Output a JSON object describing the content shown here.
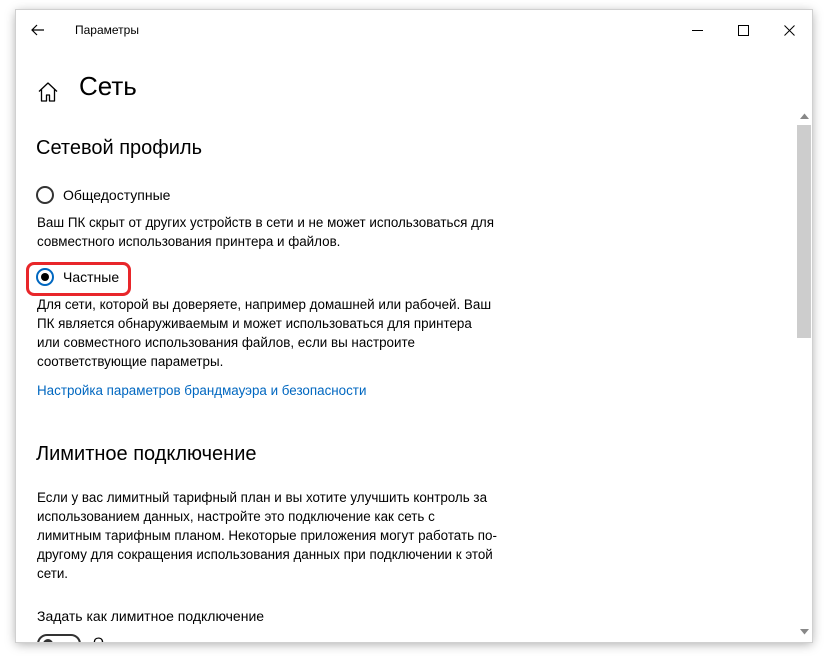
{
  "window": {
    "title": "Параметры"
  },
  "page": {
    "title": "Сеть"
  },
  "network_profile": {
    "heading": "Сетевой профиль",
    "options": [
      {
        "label": "Общедоступные",
        "checked": false,
        "description": "Ваш ПК скрыт от других устройств в сети и не может использоваться для совместного использования принтера и файлов."
      },
      {
        "label": "Частные",
        "checked": true,
        "description": "Для сети, которой вы доверяете, например домашней или рабочей. Ваш ПК является обнаруживаемым и может использоваться для принтера или совместного использования файлов, если вы настроите соответствующие параметры."
      }
    ],
    "firewall_link": "Настройка параметров брандмауэра и безопасности"
  },
  "metered": {
    "heading": "Лимитное подключение",
    "description": "Если у вас лимитный тарифный план и вы хотите улучшить контроль за использованием данных, настройте это подключение как сеть с лимитным тарифным планом. Некоторые приложения могут работать по-другому для сокращения использования данных при подключении к этой сети.",
    "toggle_label": "Задать как лимитное подключение",
    "toggle_state": "О"
  },
  "colors": {
    "accent": "#0067c0",
    "highlight": "#e8262a"
  }
}
